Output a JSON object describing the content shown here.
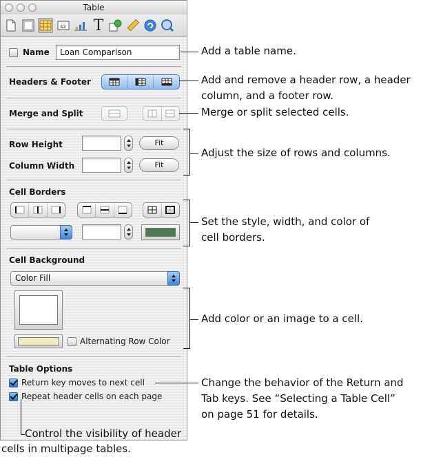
{
  "window": {
    "title": "Table",
    "toolbar_icons": [
      "document-icon",
      "layout-icon",
      "table-icon",
      "metrics-icon",
      "chart-icon",
      "text-icon",
      "graphic-icon",
      "ruler-icon",
      "link-icon",
      "quicktime-icon"
    ],
    "selected_toolbar_icon": "table-icon"
  },
  "name_row": {
    "label": "Name",
    "checked": false,
    "value": "Loan Comparison"
  },
  "headers_footer": {
    "label": "Headers & Footer"
  },
  "merge_split": {
    "label": "Merge and Split"
  },
  "row_height": {
    "label": "Row Height",
    "value": "",
    "fit": "Fit"
  },
  "column_width": {
    "label": "Column Width",
    "value": "",
    "fit": "Fit"
  },
  "cell_borders": {
    "label": "Cell Borders",
    "style_value": "",
    "width_value": "",
    "color": "#4d7a52"
  },
  "cell_background": {
    "label": "Cell Background",
    "fill_type": "Color Fill",
    "fill_color": "#ffffff",
    "alt_color": "#f3e9c7",
    "alternating_label": "Alternating Row Color",
    "alternating_checked": false
  },
  "table_options": {
    "label": "Table Options",
    "return_key": {
      "label": "Return key moves to next cell",
      "checked": true
    },
    "repeat_header": {
      "label": "Repeat header cells on each page",
      "checked": true
    }
  },
  "callouts": {
    "name": "Add a table name.",
    "headers_1": "Add and remove a header row, a header",
    "headers_2": "column, and a footer row.",
    "merge": "Merge or split selected cells.",
    "size": "Adjust the size of rows and columns.",
    "borders_1": "Set the style, width, and color of",
    "borders_2": "cell borders.",
    "background": "Add color or an image to a cell.",
    "return_1": "Change the behavior of the Return and",
    "return_2": "Tab keys. See “Selecting a Table Cell”",
    "return_3": "on page 51 for details.",
    "visibility_1": "Control the visibility of header",
    "visibility_2": "cells in multipage tables."
  }
}
